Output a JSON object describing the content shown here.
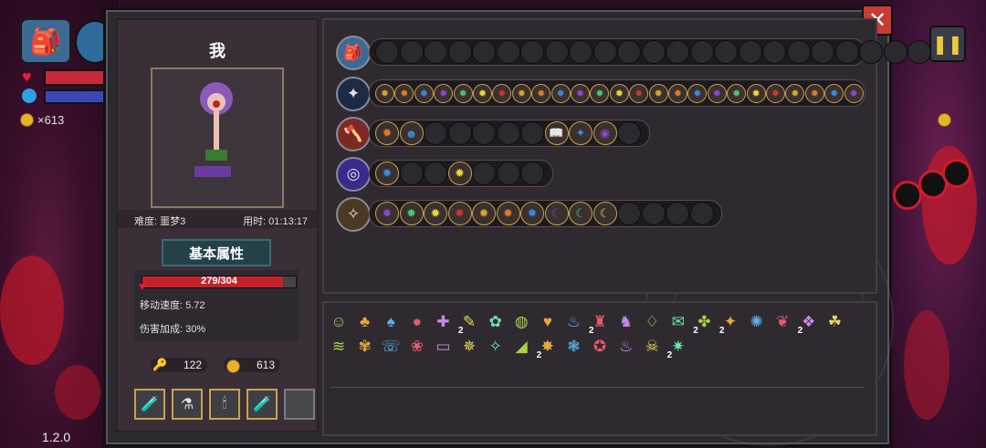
{
  "hud": {
    "coins": "×613",
    "version": "1.2.0"
  },
  "character": {
    "name": "我",
    "difficulty": "难度: 噩梦3",
    "time": "用时: 01:13:17",
    "attr_tab": "基本属性",
    "hp_text": "279/304",
    "hp_fraction": 0.918,
    "move_speed": "移动速度: 5.72",
    "damage_bonus": "伤害加成: 30%",
    "keys": "122",
    "coins": "613"
  },
  "potions": [
    "🧪",
    "⚗",
    "🕯",
    "🧪",
    ""
  ],
  "weapon_rows": [
    {
      "icon": "🎒",
      "icon_color": "#3d6a95",
      "slots": [
        "",
        "",
        "",
        "",
        "",
        "",
        "",
        "",
        "",
        "",
        "",
        "",
        "",
        "",
        "",
        "",
        "",
        "",
        "",
        "",
        "",
        "",
        ""
      ]
    },
    {
      "icon": "✦",
      "icon_color": "#1d2a44",
      "slots": [
        "✹",
        "✹",
        "✹",
        "✹",
        "✹",
        "✹",
        "✹",
        "✹",
        "✹",
        "✹",
        "✹",
        "✹",
        "✹",
        "✹",
        "✹",
        "✹",
        "✹",
        "✹",
        "✹",
        "✹",
        "✹",
        "✹",
        "✹",
        "✹",
        "✹"
      ]
    },
    {
      "icon": "🪓",
      "icon_color": "#7a2a22",
      "slots": [
        "✹",
        "☻",
        "",
        "",
        "",
        "",
        "",
        "📖",
        "✦",
        "◉",
        ""
      ]
    },
    {
      "icon": "◎",
      "icon_color": "#3a2a8a",
      "slots": [
        "✹",
        "",
        "",
        "✹",
        "",
        "",
        ""
      ]
    },
    {
      "icon": "✧",
      "icon_color": "#4a3a22",
      "slots": [
        "✹",
        "✹",
        "✹",
        "✹",
        "✹",
        "✹",
        "✹",
        "☾",
        "☾",
        "☾",
        "",
        "",
        "",
        ""
      ]
    }
  ],
  "items_row1": [
    {
      "g": "☺",
      "c": ""
    },
    {
      "g": "♣",
      "c": ""
    },
    {
      "g": "♠",
      "c": ""
    },
    {
      "g": "●",
      "c": ""
    },
    {
      "g": "✚",
      "c": "2"
    },
    {
      "g": "✎",
      "c": ""
    },
    {
      "g": "✿",
      "c": ""
    },
    {
      "g": "◍",
      "c": ""
    },
    {
      "g": "♥",
      "c": ""
    },
    {
      "g": "♨",
      "c": "2"
    },
    {
      "g": "♜",
      "c": ""
    },
    {
      "g": "♞",
      "c": ""
    },
    {
      "g": "♢",
      "c": ""
    },
    {
      "g": "✉",
      "c": "2"
    },
    {
      "g": "✤",
      "c": "2"
    },
    {
      "g": "✦",
      "c": ""
    },
    {
      "g": "✺",
      "c": ""
    },
    {
      "g": "❦",
      "c": "2"
    },
    {
      "g": "❖",
      "c": ""
    },
    {
      "g": "☘",
      "c": ""
    }
  ],
  "items_row2": [
    {
      "g": "≋",
      "c": ""
    },
    {
      "g": "✾",
      "c": ""
    },
    {
      "g": "☏",
      "c": ""
    },
    {
      "g": "❀",
      "c": ""
    },
    {
      "g": "▭",
      "c": ""
    },
    {
      "g": "✵",
      "c": ""
    },
    {
      "g": "✧",
      "c": ""
    },
    {
      "g": "◢",
      "c": "2"
    },
    {
      "g": "✸",
      "c": ""
    },
    {
      "g": "❃",
      "c": ""
    },
    {
      "g": "✪",
      "c": ""
    },
    {
      "g": "♨",
      "c": ""
    },
    {
      "g": "☠",
      "c": "2"
    },
    {
      "g": "✷",
      "c": ""
    }
  ],
  "colors": {
    "accent": "#c9a34a",
    "hp": "#c42028",
    "panel": "#2a2a30"
  }
}
